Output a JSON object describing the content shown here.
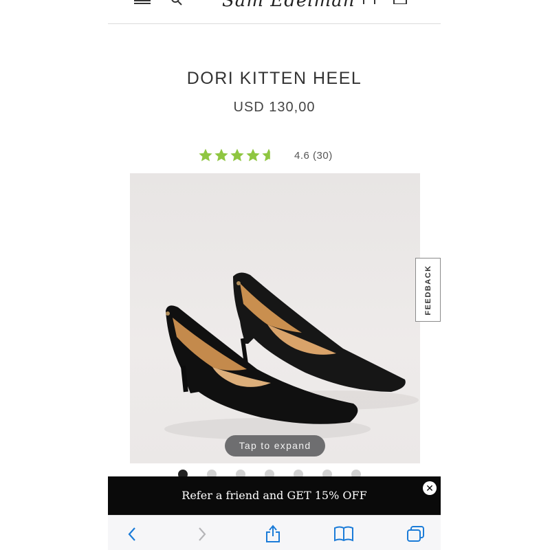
{
  "header": {
    "logo_text": "Sam Edelman",
    "icons": [
      "menu-icon",
      "search-icon",
      "account-icon",
      "bag-icon"
    ]
  },
  "product": {
    "title": "DORI KITTEN HEEL",
    "price": "USD 130,00",
    "rating_text": "4.6 (30)",
    "rating_value": 4.6,
    "rating_max": 5,
    "star_color": "#8fc641"
  },
  "gallery": {
    "expand_label": "Tap to expand",
    "dot_count": 7,
    "active_index": 0
  },
  "feedback": {
    "label": "FEEDBACK"
  },
  "promo": {
    "text": "Refer a friend and GET 15% OFF",
    "close_icon": "close-icon"
  },
  "browser_toolbar": {
    "icons": [
      "back-icon",
      "forward-icon",
      "share-icon",
      "bookmarks-icon",
      "tabs-icon"
    ],
    "accent": "#1a7bd8"
  }
}
